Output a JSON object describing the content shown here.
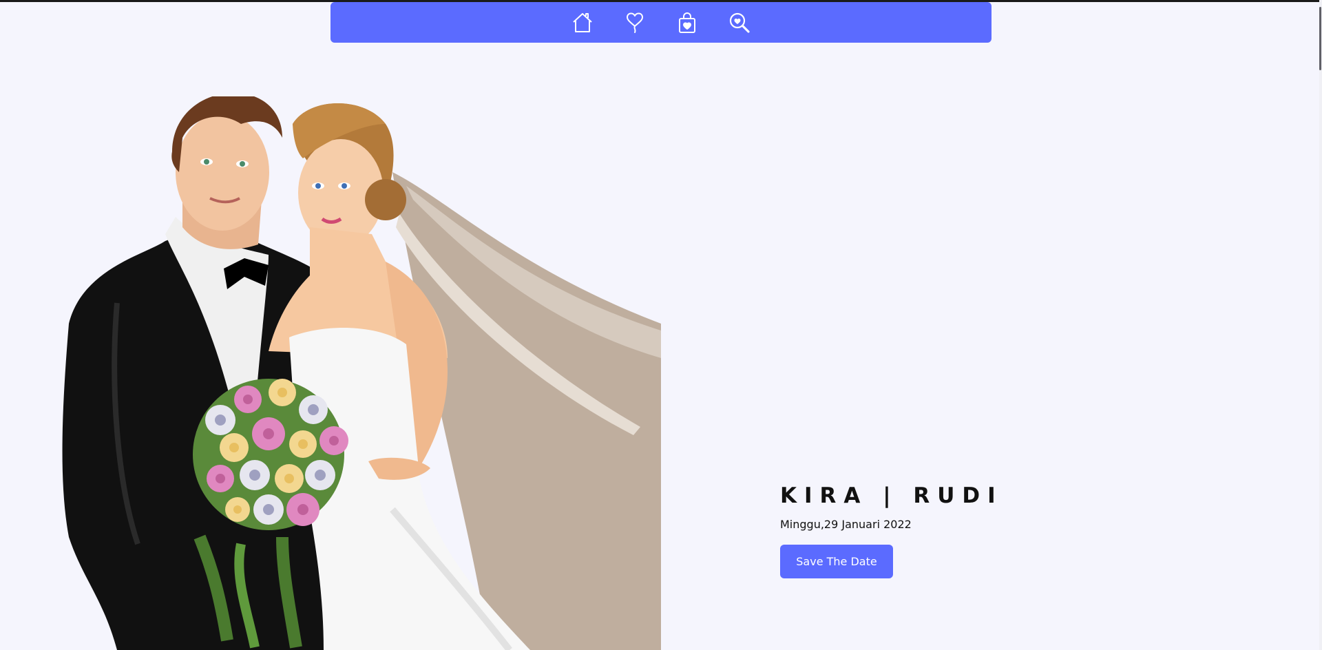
{
  "nav": {
    "items": [
      {
        "icon": "home-icon"
      },
      {
        "icon": "heart-balloon-icon"
      },
      {
        "icon": "gift-bag-icon"
      },
      {
        "icon": "search-heart-icon"
      }
    ],
    "color": "#5b6bff"
  },
  "hero": {
    "names": "KIRA | RUDI",
    "date": "Minggu,29 Januari 2022",
    "cta_label": "Save The Date"
  },
  "colors": {
    "accent": "#5b6bff",
    "background": "#f5f5fd"
  }
}
